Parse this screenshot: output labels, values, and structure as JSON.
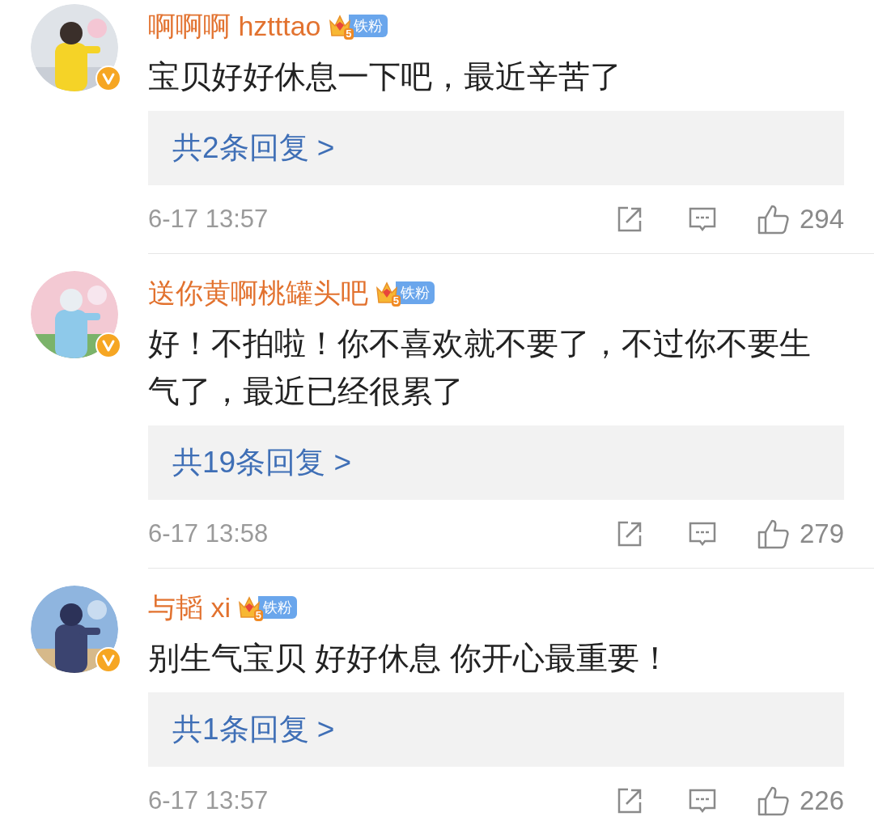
{
  "comments": [
    {
      "avatar": {
        "kind": "picture",
        "verified": true
      },
      "name": "啊啊啊 hztttao",
      "badge": {
        "level": "5",
        "label": "铁粉"
      },
      "text": "宝贝好好休息一下吧，最近辛苦了",
      "replies": "共2条回复 >",
      "time": "6-17 13:57",
      "likes": "294"
    },
    {
      "avatar": {
        "kind": "picture",
        "verified": true
      },
      "name": "送你黄啊桃罐头吧",
      "badge": {
        "level": "5",
        "label": "铁粉"
      },
      "text": "好！不拍啦！你不喜欢就不要了，不过你不要生气了，最近已经很累了",
      "replies": "共19条回复 >",
      "time": "6-17 13:58",
      "likes": "279"
    },
    {
      "avatar": {
        "kind": "picture",
        "verified": true
      },
      "name": "与韬 xi",
      "badge": {
        "level": "5",
        "label": "铁粉"
      },
      "text": "别生气宝贝 好好休息 你开心最重要！",
      "replies": "共1条回复 >",
      "time": "6-17 13:57",
      "likes": "226"
    }
  ]
}
